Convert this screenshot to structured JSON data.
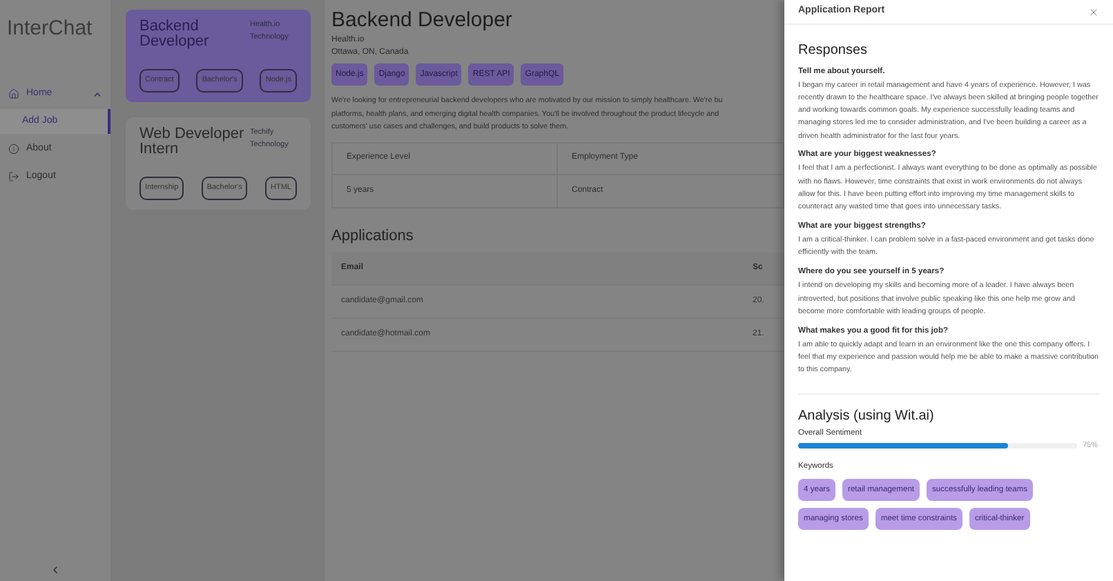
{
  "app": {
    "logo": "InterChat"
  },
  "sidebar": {
    "items": [
      {
        "label": "Home",
        "selected": false,
        "expanded": true,
        "children": [
          {
            "label": "Add Job",
            "selected": true
          }
        ]
      },
      {
        "label": "About",
        "selected": false
      },
      {
        "label": "Logout",
        "selected": false
      }
    ]
  },
  "jobs": [
    {
      "title": "Backend Developer",
      "company": "Health.io Technology",
      "selected": true,
      "tags": [
        "Contract",
        "Bachelor's",
        "Node.js"
      ]
    },
    {
      "title": "Web Developer Intern",
      "company": "Techify Technology",
      "selected": false,
      "tags": [
        "Internship",
        "Bachelor's",
        "HTML"
      ]
    }
  ],
  "job_detail": {
    "title": "Backend Developer",
    "company": "Health.io",
    "location": "Ottawa, ON, Canada",
    "skills": [
      "Node.js",
      "Django",
      "Javascript",
      "REST API",
      "GraphQL"
    ],
    "description_lines": [
      "We're looking for entrepreneurial backend developers who are motivated by our mission to simply healthcare. We're bu",
      "platforms, health plans, and emerging digital health companies. You'll be involved throughout the product lifecycle and",
      "customers' use cases and challenges, and build products to solve them."
    ],
    "details": {
      "columns": [
        "Experience Level",
        "Employment Type"
      ],
      "rows": [
        [
          "5 years",
          "Contract"
        ]
      ]
    }
  },
  "applications": {
    "heading": "Applications",
    "columns": [
      "Email",
      "Sc"
    ],
    "rows": [
      [
        "candidate@gmail.com",
        "20."
      ],
      [
        "candidate@hotmail.com",
        "21."
      ]
    ]
  },
  "report": {
    "title": "Application Report",
    "responses": {
      "heading": "Responses",
      "items": [
        {
          "question": "Tell me about yourself.",
          "answer": "I began my career in retail management and have 4 years of experience. However, I was recently drawn to the healthcare space. I've always been skilled at bringing people together and working towards common goals. My experience successfully leading teams and managing stores led me to consider administration, and I've been building a career as a driven health administrator for the last four years."
        },
        {
          "question": "What are your biggest weaknesses?",
          "answer": "I feel that I am a perfectionist. I always want everything to be done as optimally as possible with no flaws. However, time constraints that exist in work environments do not always allow for this. I have been putting effort into improving my time management skills to counteract any wasted time that goes into unnecessary tasks."
        },
        {
          "question": "What are your biggest strengths?",
          "answer": "I am a critical-thinker. I can problem solve in a fast-paced environment and get tasks done efficiently with the team."
        },
        {
          "question": "Where do you see yourself in 5 years?",
          "answer": "I intend on developing my skills and becoming more of a leader. I have always been introverted, but positions that involve public speaking like this one help me grow and become more comfortable with leading groups of people."
        },
        {
          "question": "What makes you a good fit for this job?",
          "answer": "I am able to quickly adapt and learn in an environment like the one this company offers. I feel that my experience and passion would help me be able to make a massive contribution to this company."
        }
      ]
    },
    "analysis": {
      "heading": "Analysis (using Wit.ai)",
      "sentiment": {
        "label": "Overall Sentiment",
        "level": 0.75,
        "reading": "75%"
      },
      "keywords": {
        "label": "Keywords",
        "tags": [
          "4 years",
          "retail management",
          "successfully leading teams",
          "managing stores",
          "meet time constraints",
          "critical-thinker"
        ]
      }
    }
  }
}
